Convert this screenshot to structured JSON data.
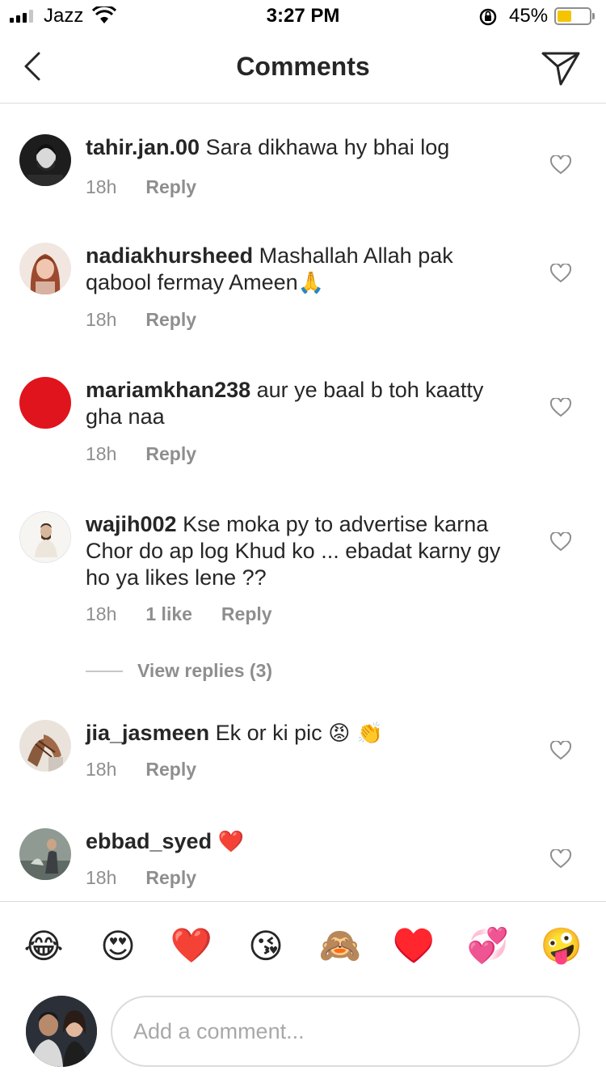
{
  "status_bar": {
    "carrier": "Jazz",
    "time": "3:27 PM",
    "battery_percent": "45%",
    "battery_level": 0.45,
    "signal_bars_filled": 3,
    "signal_bars_total": 4
  },
  "header": {
    "title": "Comments",
    "back_icon": "chevron-left-icon",
    "share_icon": "send-icon"
  },
  "comments": [
    {
      "username": "tahir.jan.00",
      "text": "Sara dikhawa hy bhai log",
      "time": "18h",
      "reply_label": "Reply",
      "avatar_color": "#2b2b2b"
    },
    {
      "username": "nadiakhursheed",
      "text": "Mashallah Allah pak qabool fermay Ameen",
      "emoji": "🙏",
      "time": "18h",
      "reply_label": "Reply",
      "avatar_color": "#c98a76"
    },
    {
      "username": "mariamkhan238",
      "text": "aur ye baal b toh kaatty gha naa",
      "time": "18h",
      "reply_label": "Reply",
      "avatar_color": "#e0141c"
    },
    {
      "username": "wajih002",
      "text": "Kse moka py to advertise karna Chor do ap log Khud ko ... ebadat karny gy ho ya likes lene ??",
      "time": "18h",
      "likes": "1 like",
      "reply_label": "Reply",
      "avatar_color": "#f4f1ee"
    },
    {
      "username": "jia_jasmeen",
      "text": "Ek or ki pic",
      "emoji": "😡 👏",
      "time": "18h",
      "reply_label": "Reply",
      "avatar_color": "#b7a79a"
    },
    {
      "username": "ebbad_syed",
      "text": "",
      "emoji": "❤️",
      "time": "18h",
      "reply_label": "Reply",
      "avatar_color": "#6d7a72"
    }
  ],
  "view_replies": "View replies (3)",
  "emoji_bar": [
    "😂",
    "😍",
    "❤️",
    "😘",
    "🙈",
    "♥️",
    "💞",
    "🤪"
  ],
  "composer": {
    "placeholder": "Add a comment..."
  },
  "colors": {
    "text": "#262626",
    "secondary": "#8e8e8e",
    "divider": "#dbdbdb",
    "battery": "#f5c400"
  }
}
